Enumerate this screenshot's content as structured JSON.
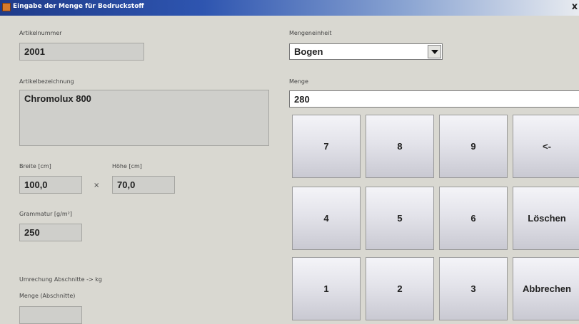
{
  "window": {
    "title": "Eingabe der Menge für Bedruckstoff",
    "close_glyph": "x"
  },
  "artikel": {
    "nummer_label": "Artikelnummer",
    "nummer_value": "2001",
    "bezeichnung_label": "Artikelbezeichnung",
    "bezeichnung_value": "Chromolux 800"
  },
  "format": {
    "breite_label": "Breite [cm]",
    "breite_value": "100,0",
    "times": "×",
    "hoehe_label": "Höhe [cm]",
    "hoehe_value": "70,0"
  },
  "grammatur": {
    "label": "Grammatur [g/m²]",
    "value": "250"
  },
  "umrechnung": {
    "title": "Umrechung Abschnitte -> kg",
    "menge_label": "Menge (Abschnitte)",
    "menge_value": ""
  },
  "mengeneinheit": {
    "label": "Mengeneinheit",
    "selected": "Bogen"
  },
  "menge": {
    "label": "Menge",
    "value": "280"
  },
  "keypad": {
    "k7": "7",
    "k8": "8",
    "k9": "9",
    "back": "<-",
    "k4": "4",
    "k5": "5",
    "k6": "6",
    "clear": "Löschen",
    "k1": "1",
    "k2": "2",
    "k3": "3",
    "cancel": "Abbrechen"
  }
}
